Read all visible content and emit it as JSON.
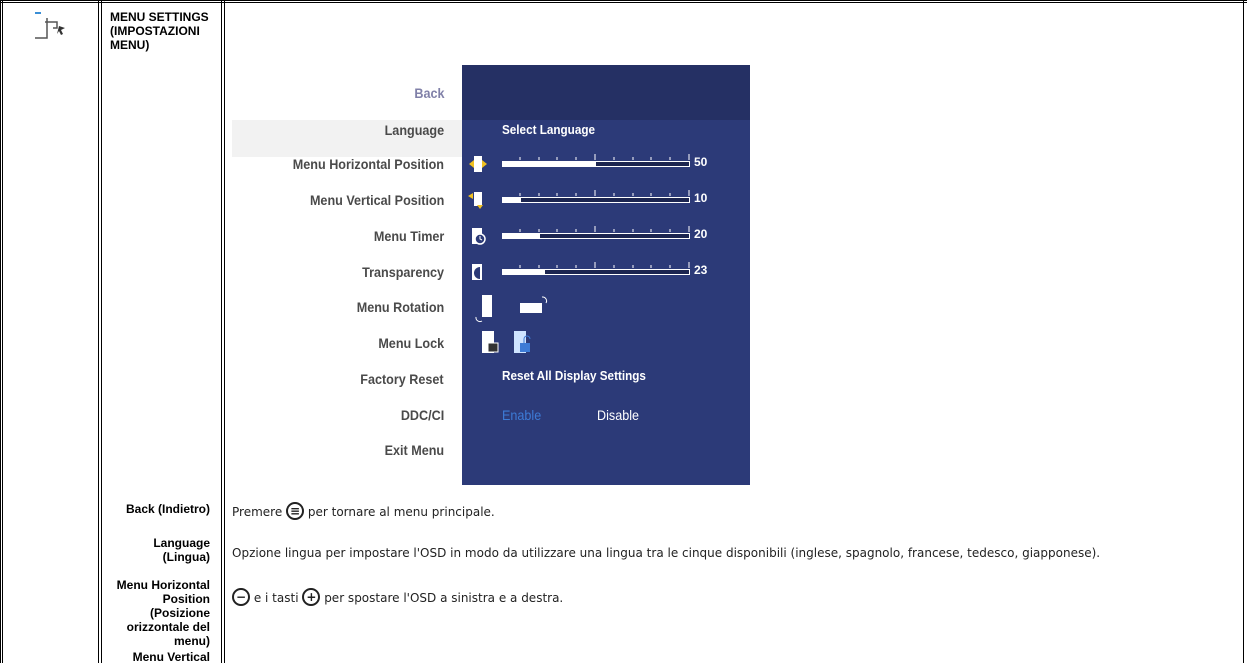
{
  "section": {
    "title": "MENU SETTINGS (IMPOSTAZIONI MENU)",
    "icon": "menu-settings-icon"
  },
  "osd": {
    "left_items": [
      "Back",
      "Language",
      "Menu Horizontal Position",
      "Menu Vertical Position",
      "Menu Timer",
      "Transparency",
      "Menu Rotation",
      "Menu Lock",
      "Factory Reset",
      "DDC/CI",
      "Exit Menu"
    ],
    "language_value": "Select Language",
    "sliders": [
      {
        "name": "Menu Horizontal Position",
        "value": 50,
        "display": "50",
        "icon": "horizontal-position-icon"
      },
      {
        "name": "Menu Vertical Position",
        "value": 10,
        "display": "10",
        "icon": "vertical-position-icon"
      },
      {
        "name": "Menu Timer",
        "value": 20,
        "display": "20",
        "icon": "timer-icon"
      },
      {
        "name": "Transparency",
        "value": 23,
        "display": "23",
        "icon": "transparency-icon"
      }
    ],
    "reset_label": "Reset All Display Settings",
    "ddc_enable": "Enable",
    "ddc_disable": "Disable",
    "colors": {
      "panel_bg": "#2c3a78",
      "header_bg": "#253064",
      "enable_text": "#3d7bd6"
    }
  },
  "rows": [
    {
      "label": "Back (Indietro)",
      "text_before": "Premere",
      "text_after": "per tornare al menu principale.",
      "icon": "menu-button-icon"
    },
    {
      "label": "Language (Lingua)",
      "text": "Opzione lingua per impostare l'OSD in modo da utilizzare una lingua tra le cinque disponibili (inglese, spagnolo, francese, tedesco, giapponese)."
    },
    {
      "label": "Menu Horizontal Position (Posizione orizzontale del menu)",
      "text_mid": "e i tasti",
      "text_after": "per spostare l'OSD a sinistra e a destra.",
      "icon1": "minus-button-icon",
      "icon2": "plus-button-icon"
    },
    {
      "label": "Menu Vertical"
    }
  ]
}
